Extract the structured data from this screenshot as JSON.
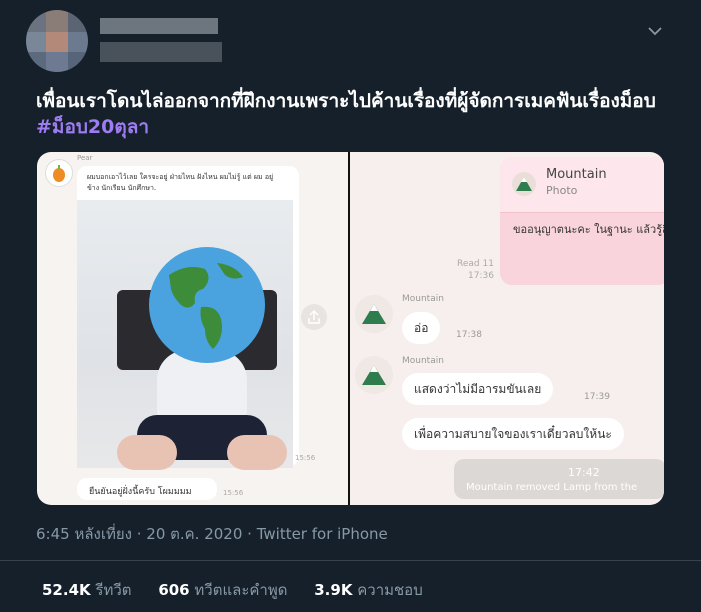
{
  "tweet": {
    "text": "เพื่อนเราโดนไล่ออกจากที่ฝึกงานเพราะไปค้านเรื่องที่ผู้จัดการเมคฟันเรื่องม็อบ",
    "hashtag": "#ม็อบ20ตุลา",
    "timestamp": "6:45 หลังเที่ยง · 20 ต.ค. 2020 · Twitter for iPhone"
  },
  "stats": {
    "retweets_value": "52.4K",
    "retweets_label": "รีทวีต",
    "quotes_value": "606",
    "quotes_label": "ทวีตและคำพูด",
    "likes_value": "3.9K",
    "likes_label": "ความชอบ"
  },
  "left_chat": {
    "sender": "Pear",
    "message1": "ผมบอกเอาไว้เลย ใครจะอยู่ ฝ่ายไหน ฝังไหน ผมไม่รู้ แต่ ผม อยู่ข้าง นักเรียน นักศึกษา.",
    "time1": "15:56",
    "message2": "ยืนยันอยู่ฝั่งนี้ครับ โผมมมม",
    "time2": "15:56"
  },
  "right_chat": {
    "card_title": "Mountain",
    "card_subtitle": "Photo",
    "pink_message": "ขออนุญาตนะคะ ในฐานะ แล้วรู้สึกไม่โอเคที่ผู้การส่ง ค่ะ เหมือนเป็นการคุกคาม",
    "read_label": "Read 11",
    "read_time": "17:36",
    "sender1": "Mountain",
    "msg1": "อ่อ",
    "time1": "17:38",
    "sender2": "Mountain",
    "msg2": "แสดงว่าไม่มีอารมขันเลย",
    "time2": "17:39",
    "msg3": "เพื่อความสบายใจของเราเดี๋ยวลบให้นะ",
    "sys_time": "17:42",
    "sys_text": "Mountain removed Lamp from the"
  },
  "icons": [
    "chevron-down-icon",
    "globe-emoji-icon",
    "share-icon",
    "mountain-avatar-icon",
    "pear-avatar-icon"
  ],
  "colors": {
    "background": "#15202b",
    "hashtag": "#9e7cf2",
    "meta": "#8899a6"
  }
}
